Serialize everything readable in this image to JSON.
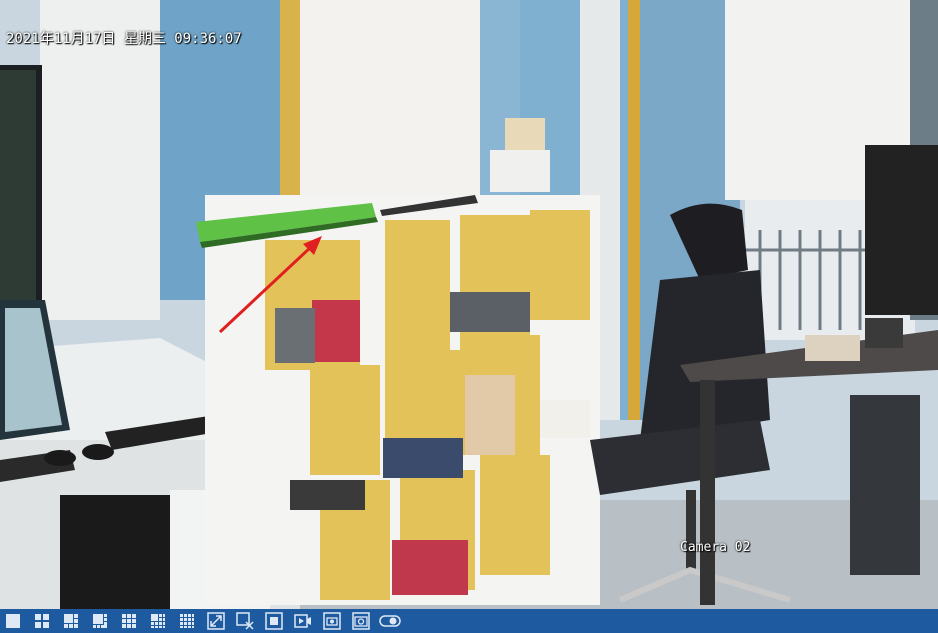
{
  "osd": {
    "datetime": "2021年11月17日 星期三 09:36:07",
    "camera_name": "Camera 02"
  },
  "toolbar": {
    "buttons": [
      {
        "icon": "layout-1x1-icon"
      },
      {
        "icon": "layout-2x2-icon"
      },
      {
        "icon": "layout-1-plus-5-icon"
      },
      {
        "icon": "layout-1-plus-7-icon"
      },
      {
        "icon": "layout-3x3-icon"
      },
      {
        "icon": "layout-4x4-custom-icon"
      },
      {
        "icon": "layout-4x4-icon"
      },
      {
        "icon": "fullscreen-icon"
      },
      {
        "icon": "close-all-icon"
      },
      {
        "icon": "fit-window-icon"
      },
      {
        "icon": "playback-icon"
      },
      {
        "icon": "snapshot-icon"
      },
      {
        "icon": "snapshot-all-icon"
      },
      {
        "icon": "toggle-icon"
      }
    ]
  },
  "colors": {
    "toolbar_bg": "#1e5aa0",
    "arrow": "#e02020",
    "osd_text": "#ffffff"
  }
}
